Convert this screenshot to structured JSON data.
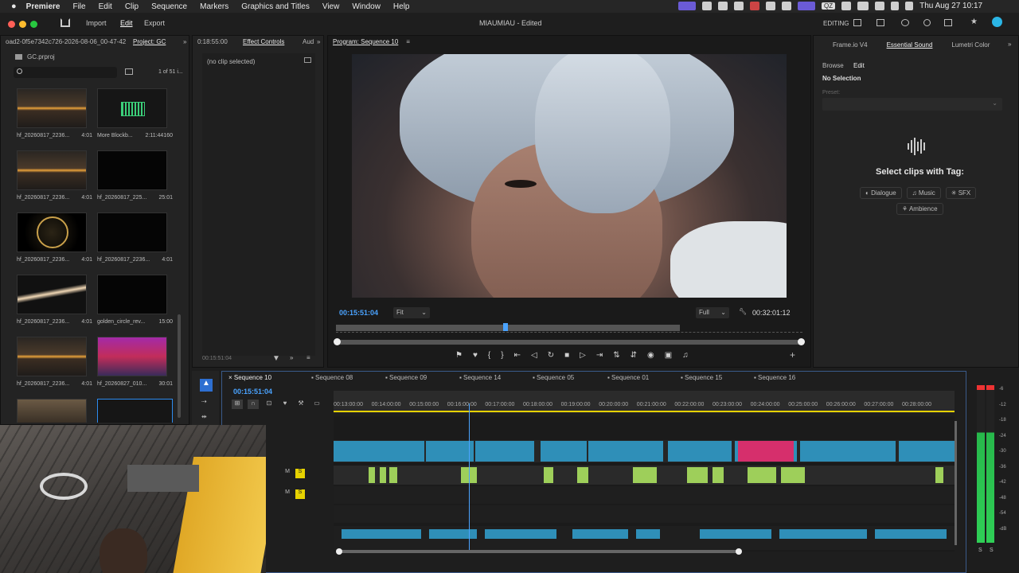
{
  "menubar": {
    "items": [
      "Premiere",
      "File",
      "Edit",
      "Clip",
      "Sequence",
      "Markers",
      "Graphics and Titles",
      "View",
      "Window",
      "Help"
    ],
    "clock": "Thu Aug 27  10:17",
    "keyboard_badge": "QZ"
  },
  "header": {
    "title": "MIAUMIAU - Edited",
    "tabs": [
      "Import",
      "Edit",
      "Export"
    ],
    "mode": "EDITING"
  },
  "project": {
    "breadcrumb": "oad2-0f5e7342c726-2026-08-06_00-47-42",
    "panel_title": "Project: GC",
    "file": "GC.prproj",
    "count": "1 of 51 i...",
    "items": [
      {
        "name": "hf_20260817_2236...",
        "dur": "4:01",
        "kind": "flare"
      },
      {
        "name": "More Blockb...",
        "dur": "2:11:44160",
        "kind": "audio"
      },
      {
        "name": "hf_20260817_2236...",
        "dur": "4:01",
        "kind": "flare"
      },
      {
        "name": "hf_20260817_225...",
        "dur": "25:01",
        "kind": "black"
      },
      {
        "name": "hf_20260817_2236...",
        "dur": "4:01",
        "kind": "gold"
      },
      {
        "name": "hf_20260817_2236...",
        "dur": "4:01",
        "kind": "black"
      },
      {
        "name": "hf_20260817_2236...",
        "dur": "4:01",
        "kind": "beam"
      },
      {
        "name": "golden_circle_rev...",
        "dur": "15:00",
        "kind": "black"
      },
      {
        "name": "hf_20260817_2236...",
        "dur": "4:01",
        "kind": "flare"
      },
      {
        "name": "hf_20260827_010...",
        "dur": "30:01",
        "kind": "person"
      }
    ]
  },
  "effects": {
    "header_tc": "0:18:55:00",
    "tab": "Effect Controls",
    "tab2": "Aud",
    "empty": "(no clip selected)",
    "footer_tc": "00:15:51:04"
  },
  "program": {
    "title": "Program: Sequence 10",
    "timecode": "00:15:51:04",
    "fit": "Fit",
    "quality": "Full",
    "duration": "00:32:01:12"
  },
  "right_panel": {
    "tabs": [
      "Frame.io V4",
      "Essential Sound",
      "Lumetri Color"
    ],
    "subtabs": [
      "Browse",
      "Edit"
    ],
    "no_selection": "No Selection",
    "preset": "Preset:",
    "prompt": "Select clips with Tag:",
    "tags": [
      "Dialogue",
      "Music",
      "SFX",
      "Ambience"
    ]
  },
  "timeline": {
    "tabs": [
      "Sequence 10",
      "Sequence 08",
      "Sequence 09",
      "Sequence 14",
      "Sequence 05",
      "Sequence 01",
      "Sequence 15",
      "Sequence 16"
    ],
    "timecode": "00:15:51:04",
    "ruler": [
      "00:13:00:00",
      "00:14:00:00",
      "00:15:00:00",
      "00:16:00:00",
      "00:17:00:00",
      "00:18:00:00",
      "00:19:00:00",
      "00:20:00:00",
      "00:21:00:00",
      "00:22:00:00",
      "00:23:00:00",
      "00:24:00:00",
      "00:25:00:00",
      "00:26:00:00",
      "00:27:00:00",
      "00:28:00:00"
    ],
    "track_letters": {
      "m": "M",
      "s": "S"
    }
  },
  "meter": {
    "ticks": [
      "-6",
      "-12",
      "-18",
      "-24",
      "-30",
      "-36",
      "-42",
      "-48",
      "-54",
      "-dB"
    ],
    "footer": [
      "S",
      "S"
    ]
  },
  "colors": {
    "accent": "#2d8cf0",
    "clip_blue": "#2f8fb8",
    "audio_green": "#9ecf5a",
    "pink": "#d62f6c",
    "yellow": "#e6d200"
  }
}
